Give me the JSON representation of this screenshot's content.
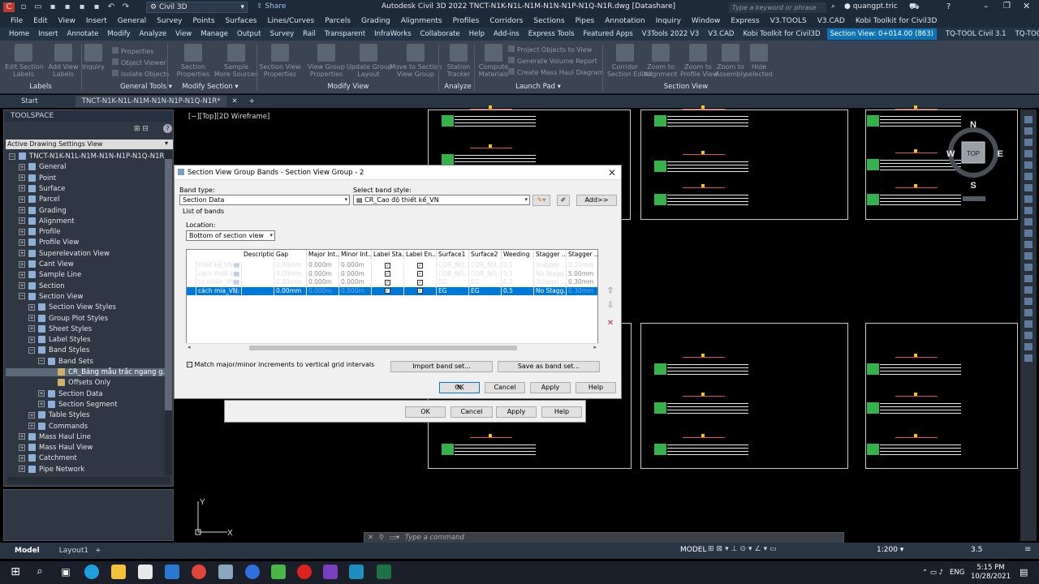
{
  "app": {
    "title": "Autodesk Civil 3D 2022   TNCT-N1K-N1L-N1M-N1N-N1P-N1Q-N1R.dwg [Datashare]",
    "workspace": "Civil 3D",
    "share_label": "Share",
    "search_placeholder": "Type a keyword or phrase",
    "user": "quangpt.tric"
  },
  "menu": [
    "File",
    "Edit",
    "View",
    "Insert",
    "General",
    "Survey",
    "Points",
    "Surfaces",
    "Lines/Curves",
    "Parcels",
    "Grading",
    "Alignments",
    "Profiles",
    "Corridors",
    "Sections",
    "Pipes",
    "Annotation",
    "Inquiry",
    "Window",
    "Express",
    "V3.TOOLS",
    "V3.CAD",
    "Kobi Toolkit for Civil3D"
  ],
  "ribbon_tabs": [
    "Home",
    "Insert",
    "Annotate",
    "Modify",
    "Analyze",
    "View",
    "Manage",
    "Output",
    "Survey",
    "Rail",
    "Transparent",
    "InfraWorks",
    "Collaborate",
    "Help",
    "Add-ins",
    "Express Tools",
    "Featured Apps",
    "V3Tools 2022 V3",
    "V3.CAD",
    "Kobi Toolkit for Civil3D",
    "Section View: 0+014.00 (863)",
    "TQ-TOOL Civil 3.1",
    "TQ-TOOL Cad 2.0"
  ],
  "ribbon": {
    "buttons": [
      {
        "label": "Edit Section\nLabels"
      },
      {
        "label": "Add View\nLabels"
      },
      {
        "label": "Inquiry"
      },
      {
        "label": "Section\nProperties"
      },
      {
        "label": "Sample\nMore Sources"
      },
      {
        "label": "Section View\nProperties"
      },
      {
        "label": "View Group\nProperties"
      },
      {
        "label": "Update Group\nLayout"
      },
      {
        "label": "Move to Section\nView Group"
      },
      {
        "label": "Station\nTracker"
      },
      {
        "label": "Compute\nMaterials"
      },
      {
        "label": "Corridor\nSection Editor"
      },
      {
        "label": "Zoom to\nAlignment"
      },
      {
        "label": "Zoom to\nProfile View"
      },
      {
        "label": "Zoom to\nAssembly"
      },
      {
        "label": "Hide\nselected"
      }
    ],
    "small": [
      "Properties",
      "Object Viewer",
      "Isolate Objects",
      "Project Objects to View",
      "Generate Volume Report",
      "Create Mass Haul Diagram"
    ],
    "panels": [
      "Labels",
      "General Tools ▾",
      "Modify Section ▾",
      "Modify View",
      "Analyze",
      "Launch Pad ▾",
      "Section View"
    ]
  },
  "doc_tabs": {
    "start": "Start",
    "current": "TNCT-N1K-N1L-N1M-N1N-N1P-N1Q-N1R*"
  },
  "toolspace": {
    "title": "TOOLSPACE",
    "dropdown": "Active Drawing Settings View",
    "tree": [
      {
        "label": "TNCT-N1K-N1L-N1M-N1N-N1P-N1Q-N1R",
        "level": 0,
        "pm": "−"
      },
      {
        "label": "General",
        "level": 1,
        "pm": "+"
      },
      {
        "label": "Point",
        "level": 1,
        "pm": "+"
      },
      {
        "label": "Surface",
        "level": 1,
        "pm": "+"
      },
      {
        "label": "Parcel",
        "level": 1,
        "pm": "+"
      },
      {
        "label": "Grading",
        "level": 1,
        "pm": "+"
      },
      {
        "label": "Alignment",
        "level": 1,
        "pm": "+"
      },
      {
        "label": "Profile",
        "level": 1,
        "pm": "+"
      },
      {
        "label": "Profile View",
        "level": 1,
        "pm": "+"
      },
      {
        "label": "Superelevation View",
        "level": 1,
        "pm": "+"
      },
      {
        "label": "Cant View",
        "level": 1,
        "pm": "+"
      },
      {
        "label": "Sample Line",
        "level": 1,
        "pm": "+"
      },
      {
        "label": "Section",
        "level": 1,
        "pm": "+"
      },
      {
        "label": "Section View",
        "level": 1,
        "pm": "−"
      },
      {
        "label": "Section View Styles",
        "level": 2,
        "pm": "+"
      },
      {
        "label": "Group Plot Styles",
        "level": 2,
        "pm": "+"
      },
      {
        "label": "Sheet Styles",
        "level": 2,
        "pm": "+"
      },
      {
        "label": "Label Styles",
        "level": 2,
        "pm": "+"
      },
      {
        "label": "Band Styles",
        "level": 2,
        "pm": "−"
      },
      {
        "label": "Band Sets",
        "level": 3,
        "pm": "−"
      },
      {
        "label": "CR_Bảng mẫu trắc ngang g...",
        "level": 4,
        "pm": "",
        "sel": true
      },
      {
        "label": "Offsets Only",
        "level": 4,
        "pm": ""
      },
      {
        "label": "Section Data",
        "level": 3,
        "pm": "+"
      },
      {
        "label": "Section Segment",
        "level": 3,
        "pm": "+"
      },
      {
        "label": "Table Styles",
        "level": 2,
        "pm": "+"
      },
      {
        "label": "Commands",
        "level": 2,
        "pm": "+"
      },
      {
        "label": "Mass Haul Line",
        "level": 1,
        "pm": "+"
      },
      {
        "label": "Mass Haul View",
        "level": 1,
        "pm": "+"
      },
      {
        "label": "Catchment",
        "level": 1,
        "pm": "+"
      },
      {
        "label": "Pipe Network",
        "level": 1,
        "pm": "+"
      }
    ]
  },
  "viewport": {
    "tag": "[−][Top][2D Wireframe]",
    "compass": {
      "n": "N",
      "s": "S",
      "e": "E",
      "w": "W",
      "top": "TOP"
    },
    "ucs": {
      "x": "X",
      "y": "Y"
    },
    "command_placeholder": "Type a command"
  },
  "dialog": {
    "title": "Section View Group Bands - Section View Group - 2",
    "band_type_label": "Band type:",
    "band_type_value": "Section Data",
    "band_style_label": "Select band style:",
    "band_style_value": "CR_Cao độ thiết kế_VN",
    "add_button": "Add>>",
    "list_label": "List of bands",
    "location_label": "Location:",
    "location_value": "Bottom of section view",
    "columns": [
      "Description",
      "Gap",
      "Major Int...",
      "Minor Int...",
      "Label Sta...",
      "Label En...",
      "Surface1",
      "Surface2",
      "Weeding",
      "Stagger ...",
      "Stagger ..."
    ],
    "rows": [
      {
        "name": "thiết kế_VN",
        "desc": "",
        "gap": "0.00mm",
        "major": "0.000m",
        "minor": "0.000m",
        "ls": "✓",
        "le": "✓",
        "s1": "COR_ÑO...",
        "s2": "COR_ÑO...",
        "weed": "0.1",
        "st1": "Stagger ...",
        "st2": "0.30mm",
        "sel": false
      },
      {
        "name": "cách thiết kế_VN",
        "desc": "",
        "gap": "0.00mm",
        "major": "0.000m",
        "minor": "0.000m",
        "ls": "✓",
        "le": "✓",
        "s1": "COR_ÑO...",
        "s2": "COR_ÑO...",
        "weed": "0.1",
        "st1": "No Stagg...",
        "st2": "5.00mm",
        "sel": false
      },
      {
        "name": "tự nhiên_VN",
        "desc": "",
        "gap": "0.00mm",
        "major": "0.000m",
        "minor": "0.000m",
        "ls": "✓",
        "le": "✓",
        "s1": "EG",
        "s2": "EG",
        "weed": "0.5",
        "st1": "Stagger ...",
        "st2": "0.30mm",
        "sel": false
      },
      {
        "name": "cách mía_VN",
        "desc": "",
        "gap": "0.00mm",
        "major": "0.000m",
        "minor": "0.000m",
        "ls": "✓",
        "le": "✓",
        "s1": "EG",
        "s2": "EG",
        "weed": "0.5",
        "st1": "No Stagg...",
        "st2": "0.30mm",
        "sel": true
      }
    ],
    "match_label": "Match major/minor increments to vertical grid intervals",
    "import_button": "Import band set...",
    "save_button": "Save as band set...",
    "ok": "OK",
    "cancel": "Cancel",
    "apply": "Apply",
    "help": "Help"
  },
  "dialog_behind": {
    "ok": "OK",
    "cancel": "Cancel",
    "apply": "Apply",
    "help": "Help"
  },
  "status": {
    "model": "Model",
    "layout": "Layout1",
    "mode": "MODEL",
    "scale": "1:200 ▾",
    "zoom": "3.5"
  },
  "clock": {
    "time": "5:15 PM",
    "date": "10/28/2021",
    "lang": "ENG"
  }
}
